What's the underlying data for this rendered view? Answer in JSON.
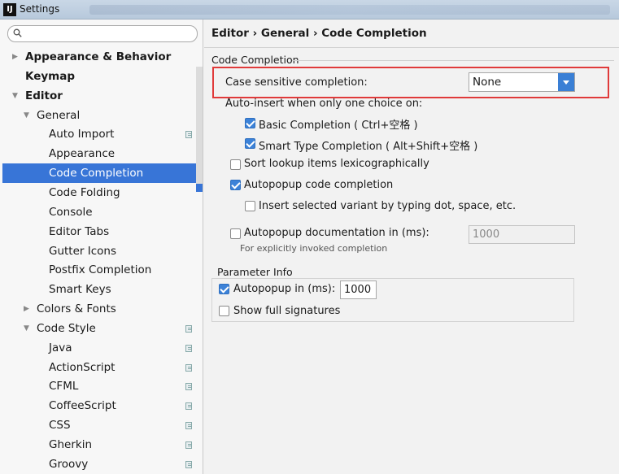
{
  "window": {
    "title": "Settings",
    "app_icon": "IJ"
  },
  "search": {
    "placeholder": ""
  },
  "tree": [
    {
      "label": "Appearance & Behavior",
      "bold": true,
      "level": 0,
      "arrow": "collapsed"
    },
    {
      "label": "Keymap",
      "bold": true,
      "level": 0,
      "arrow": "none"
    },
    {
      "label": "Editor",
      "bold": true,
      "level": 0,
      "arrow": "expanded"
    },
    {
      "label": "General",
      "bold": false,
      "level": 1,
      "arrow": "expanded"
    },
    {
      "label": "Auto Import",
      "bold": false,
      "level": 2,
      "copy": true
    },
    {
      "label": "Appearance",
      "bold": false,
      "level": 2
    },
    {
      "label": "Code Completion",
      "bold": false,
      "level": 2,
      "selected": true
    },
    {
      "label": "Code Folding",
      "bold": false,
      "level": 2
    },
    {
      "label": "Console",
      "bold": false,
      "level": 2
    },
    {
      "label": "Editor Tabs",
      "bold": false,
      "level": 2
    },
    {
      "label": "Gutter Icons",
      "bold": false,
      "level": 2
    },
    {
      "label": "Postfix Completion",
      "bold": false,
      "level": 2
    },
    {
      "label": "Smart Keys",
      "bold": false,
      "level": 2
    },
    {
      "label": "Colors & Fonts",
      "bold": false,
      "level": 1,
      "arrow": "collapsed"
    },
    {
      "label": "Code Style",
      "bold": false,
      "level": 1,
      "arrow": "expanded",
      "copy": true
    },
    {
      "label": "Java",
      "bold": false,
      "level": 2,
      "copy": true
    },
    {
      "label": "ActionScript",
      "bold": false,
      "level": 2,
      "copy": true
    },
    {
      "label": "CFML",
      "bold": false,
      "level": 2,
      "copy": true
    },
    {
      "label": "CoffeeScript",
      "bold": false,
      "level": 2,
      "copy": true
    },
    {
      "label": "CSS",
      "bold": false,
      "level": 2,
      "copy": true
    },
    {
      "label": "Gherkin",
      "bold": false,
      "level": 2,
      "copy": true
    },
    {
      "label": "Groovy",
      "bold": false,
      "level": 2,
      "copy": true
    }
  ],
  "breadcrumb": "Editor › General › Code Completion",
  "completion": {
    "group_title": "Code Completion",
    "case_label": "Case sensitive completion:",
    "case_value": "None",
    "auto_insert_label": "Auto-insert when only one choice on:",
    "basic": {
      "label": "Basic Completion ( Ctrl+空格 )",
      "checked": true
    },
    "smart": {
      "label": "Smart Type Completion ( Alt+Shift+空格 )",
      "checked": true
    },
    "sort": {
      "label": "Sort lookup items lexicographically",
      "checked": false
    },
    "autopopup": {
      "label": "Autopopup code completion",
      "checked": true
    },
    "insert_variant": {
      "label": "Insert selected variant by typing dot, space, etc.",
      "checked": false
    },
    "autopopup_doc": {
      "label": "Autopopup documentation in (ms):",
      "checked": false,
      "value": "1000"
    },
    "explicit_hint": "For explicitly invoked completion"
  },
  "param_info": {
    "group_title": "Parameter Info",
    "autopopup": {
      "label": "Autopopup in (ms):",
      "checked": true,
      "value": "1000"
    },
    "full_sig": {
      "label": "Show full signatures",
      "checked": false
    }
  },
  "colors": {
    "selection": "#3875d7",
    "highlight_box": "#e03a3a",
    "accent": "#3a7fd5"
  }
}
